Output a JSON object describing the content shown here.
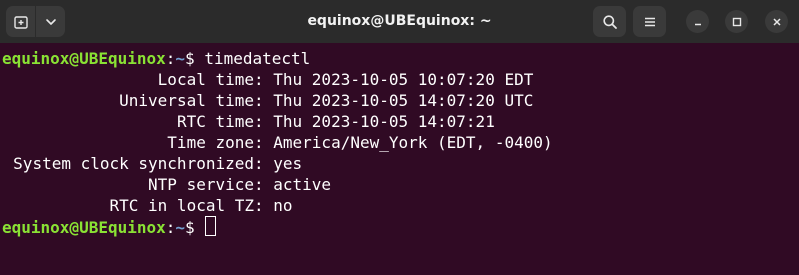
{
  "window": {
    "title": "equinox@UBEquinox: ~",
    "icons": {
      "new_tab": "new-tab-icon",
      "menu_dropdown": "chevron-down-icon",
      "search": "search-icon",
      "hamburger": "hamburger-menu-icon",
      "minimize": "minimize-icon",
      "maximize": "maximize-icon",
      "close": "close-icon"
    }
  },
  "terminal": {
    "colors": {
      "background": "#300a24",
      "user": "#8ae234",
      "path": "#729fcf",
      "text": "#ffffff"
    },
    "prompt_user": "equinox@UBEquinox",
    "prompt_sep": ":",
    "prompt_path": "~",
    "prompt_symbol": "$",
    "command": "timedatectl",
    "output": [
      {
        "key": "Local time",
        "value": "Thu 2023-10-05 10:07:20 EDT"
      },
      {
        "key": "Universal time",
        "value": "Thu 2023-10-05 14:07:20 UTC"
      },
      {
        "key": "RTC time",
        "value": "Thu 2023-10-05 14:07:21"
      },
      {
        "key": "Time zone",
        "value": "America/New_York (EDT, -0400)"
      },
      {
        "key": "System clock synchronized",
        "value": "yes"
      },
      {
        "key": "NTP service",
        "value": "active"
      },
      {
        "key": "RTC in local TZ",
        "value": "no"
      }
    ]
  }
}
